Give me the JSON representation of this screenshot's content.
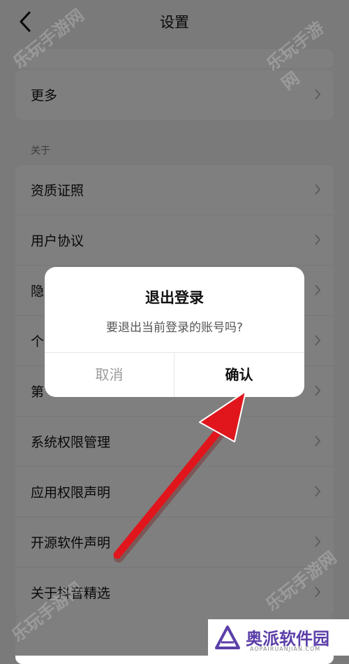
{
  "header": {
    "title": "设置"
  },
  "more_row": {
    "label": "更多"
  },
  "about_section": {
    "title": "关于"
  },
  "about_items": [
    {
      "label": "资质证照"
    },
    {
      "label": "用户协议"
    },
    {
      "label": "隐"
    },
    {
      "label": "个"
    },
    {
      "label": "第"
    },
    {
      "label": "系统权限管理"
    },
    {
      "label": "应用权限声明"
    },
    {
      "label": "开源软件声明"
    },
    {
      "label": "关于抖音精选"
    }
  ],
  "dialog": {
    "title": "退出登录",
    "message": "要退出当前登录的账号吗?",
    "cancel_label": "取消",
    "confirm_label": "确认"
  },
  "watermark": {
    "text": "乐玩手游网"
  },
  "logo": {
    "text": "奥派软件园",
    "subtext": "AOPAIRUANJIAN.COM"
  },
  "colors": {
    "annotation_arrow": "#e0161c",
    "logo": "#5b3fa8",
    "overlay": "rgba(0,0,0,0.5)"
  },
  "annotation": {
    "arrow_icon": "red-arrow-icon",
    "target": "confirm-button"
  }
}
